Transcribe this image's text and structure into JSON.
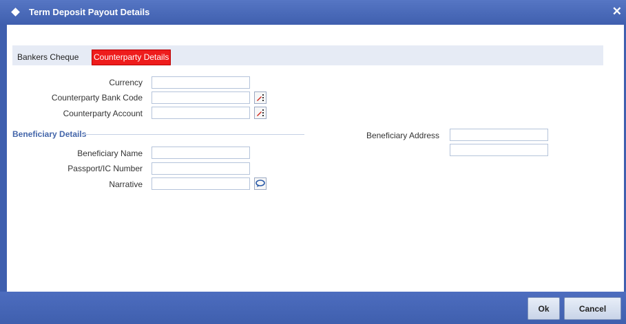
{
  "window": {
    "title": "Term Deposit Payout Details",
    "close_glyph": "✕"
  },
  "tabs": [
    {
      "label": "Bankers Cheque",
      "active": false
    },
    {
      "label": "Counterparty Details",
      "active": true
    }
  ],
  "fields": {
    "currency": {
      "label": "Currency",
      "value": ""
    },
    "counterparty_bank_code": {
      "label": "Counterparty Bank Code",
      "value": ""
    },
    "counterparty_account": {
      "label": "Counterparty Account",
      "value": ""
    },
    "beneficiary_name": {
      "label": "Beneficiary Name",
      "value": ""
    },
    "passport_ic_number": {
      "label": "Passport/IC Number",
      "value": ""
    },
    "narrative": {
      "label": "Narrative",
      "value": ""
    },
    "beneficiary_address": {
      "label": "Beneficiary Address",
      "line1": "",
      "line2": ""
    }
  },
  "sections": {
    "beneficiary_details": "Beneficiary Details"
  },
  "buttons": {
    "ok": "Ok",
    "cancel": "Cancel"
  },
  "icons": {
    "lov": "list-of-values-icon",
    "narrative": "comment-icon"
  },
  "colors": {
    "titlebar": "#4565b5",
    "active_tab": "#ee1c1c",
    "section_heading": "#4466aa"
  }
}
